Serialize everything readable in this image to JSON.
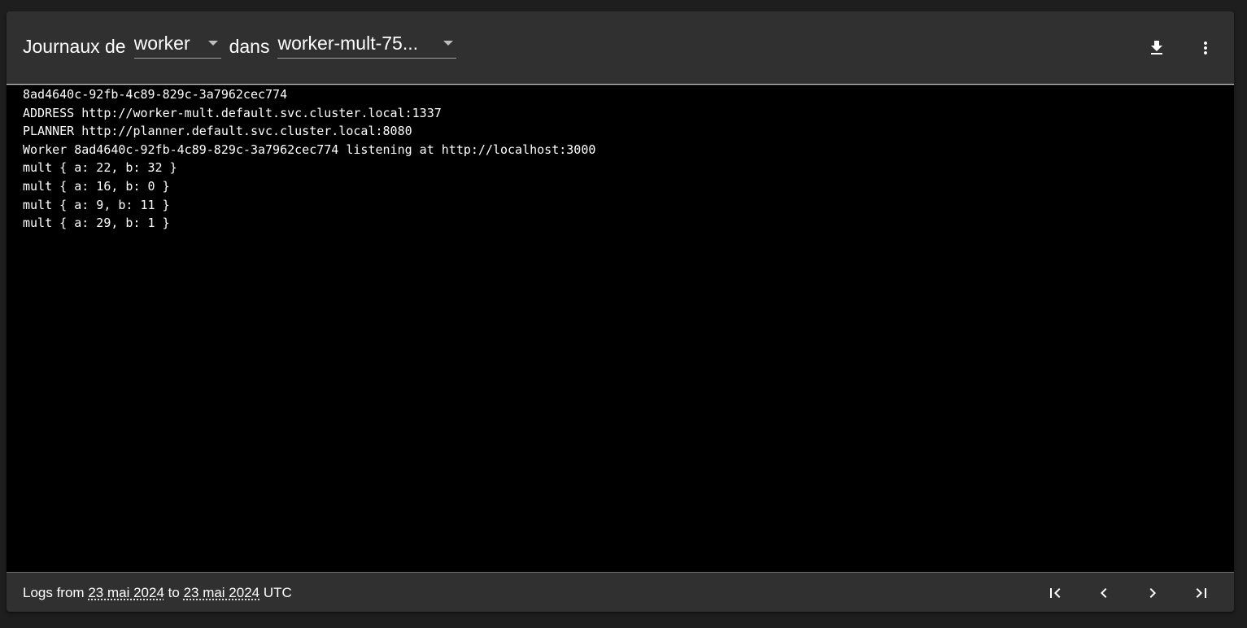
{
  "header": {
    "title": "Journaux de",
    "container_select": {
      "value": "worker"
    },
    "separator": "dans",
    "pod_select": {
      "value": "worker-mult-75..."
    },
    "actions": [
      {
        "icon": "download-icon"
      },
      {
        "icon": "more-vert-icon"
      }
    ]
  },
  "logs": {
    "lines": [
      "8ad4640c-92fb-4c89-829c-3a7962cec774",
      "ADDRESS http://worker-mult.default.svc.cluster.local:1337",
      "PLANNER http://planner.default.svc.cluster.local:8080",
      "Worker 8ad4640c-92fb-4c89-829c-3a7962cec774 listening at http://localhost:3000",
      "mult { a: 22, b: 32 }",
      "mult { a: 16, b: 0 }",
      "mult { a: 9, b: 11 }",
      "mult { a: 29, b: 1 }"
    ]
  },
  "footer": {
    "prefix": "Logs from",
    "from_date": "23 mai 2024",
    "connector": "to",
    "to_date": "23 mai 2024",
    "suffix": "UTC",
    "pager": [
      {
        "icon": "first-page-icon"
      },
      {
        "icon": "chevron-left-icon"
      },
      {
        "icon": "chevron-right-icon"
      },
      {
        "icon": "last-page-icon"
      }
    ]
  },
  "colors": {
    "page_bg": "#1e1e1e",
    "card_bg": "#303030",
    "log_bg": "#000000",
    "text": "#ffffff"
  }
}
